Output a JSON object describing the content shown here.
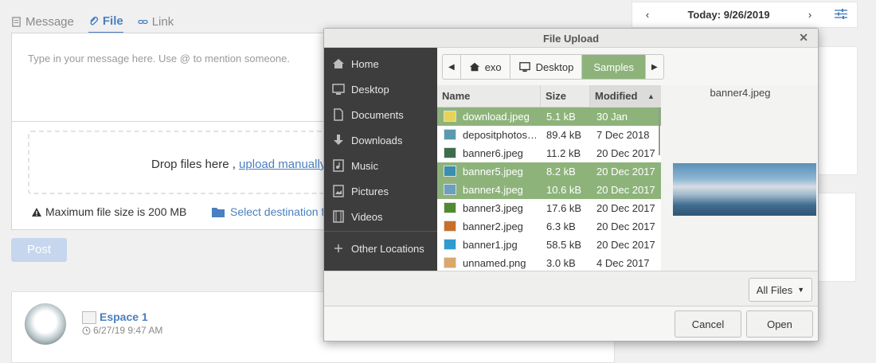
{
  "composer": {
    "tabs": [
      {
        "label": "Message",
        "icon": "message-icon"
      },
      {
        "label": "File",
        "icon": "paperclip-icon"
      },
      {
        "label": "Link",
        "icon": "link-icon"
      }
    ],
    "placeholder": "Type in your message here. Use @ to mention someone.",
    "drop_text": "Drop files here , ",
    "upload_link": "upload manually o",
    "max_size": "Maximum file size is 200 MB",
    "select_destination": "Select destination f",
    "post_label": "Post"
  },
  "activity": {
    "space_name": "Espace 1",
    "timestamp": "6/27/19 9:47 AM"
  },
  "calendar": {
    "prev": "‹",
    "today_label": "Today: 9/26/2019",
    "next": "›"
  },
  "dialog": {
    "title": "File Upload",
    "close": "✕",
    "sidebar": [
      {
        "label": "Home",
        "icon": "home-icon"
      },
      {
        "label": "Desktop",
        "icon": "desktop-icon"
      },
      {
        "label": "Documents",
        "icon": "documents-icon"
      },
      {
        "label": "Downloads",
        "icon": "downloads-icon"
      },
      {
        "label": "Music",
        "icon": "music-icon"
      },
      {
        "label": "Pictures",
        "icon": "pictures-icon"
      },
      {
        "label": "Videos",
        "icon": "videos-icon"
      },
      {
        "label": "Other Locations",
        "icon": "plus-icon"
      }
    ],
    "path": {
      "back": "◀",
      "crumbs": [
        "exo",
        "Desktop",
        "Samples"
      ],
      "forward": "▶"
    },
    "columns": {
      "name": "Name",
      "size": "Size",
      "modified": "Modified"
    },
    "files": [
      {
        "name": "download.jpeg",
        "size": "5.1 kB",
        "modified": "30 Jan",
        "selected": true,
        "thumb": "#e8d35a"
      },
      {
        "name": "depositphotos…",
        "size": "89.4 kB",
        "modified": "7 Dec 2018",
        "selected": false,
        "thumb": "#5a9ab0"
      },
      {
        "name": "banner6.jpeg",
        "size": "11.2 kB",
        "modified": "20 Dec 2017",
        "selected": false,
        "thumb": "#3d6e4a"
      },
      {
        "name": "banner5.jpeg",
        "size": "8.2 kB",
        "modified": "20 Dec 2017",
        "selected": true,
        "thumb": "#3a8fb0"
      },
      {
        "name": "banner4.jpeg",
        "size": "10.6 kB",
        "modified": "20 Dec 2017",
        "selected": true,
        "thumb": "#6a9fc0"
      },
      {
        "name": "banner3.jpeg",
        "size": "17.6 kB",
        "modified": "20 Dec 2017",
        "selected": false,
        "thumb": "#4f8a2f"
      },
      {
        "name": "banner2.jpeg",
        "size": "6.3 kB",
        "modified": "20 Dec 2017",
        "selected": false,
        "thumb": "#c8702a"
      },
      {
        "name": "banner1.jpg",
        "size": "58.5 kB",
        "modified": "20 Dec 2017",
        "selected": false,
        "thumb": "#2e9ccf"
      },
      {
        "name": "unnamed.png",
        "size": "3.0 kB",
        "modified": "4 Dec 2017",
        "selected": false,
        "thumb": "#d9a86a"
      }
    ],
    "preview_name": "banner4.jpeg",
    "filter_label": "All Files",
    "cancel_label": "Cancel",
    "open_label": "Open"
  },
  "colors": {
    "accent": "#4a7fc1",
    "selection": "#8db37a",
    "sidebar_bg": "#3d3d3d"
  }
}
